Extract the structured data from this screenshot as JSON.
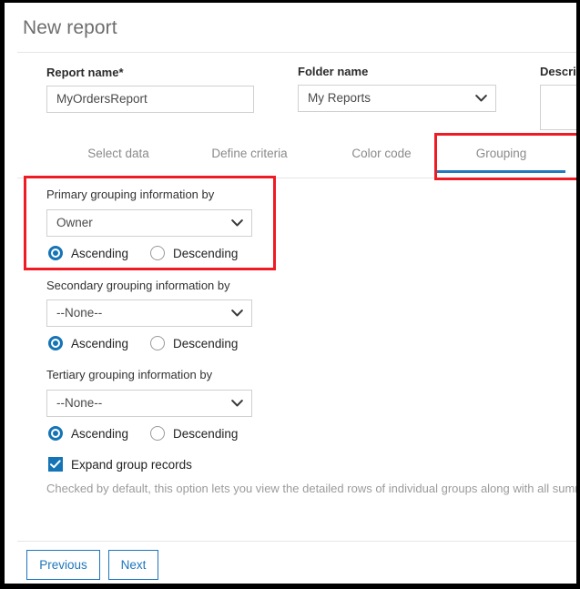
{
  "window": {
    "title": "New report"
  },
  "form": {
    "report_name": {
      "label": "Report name*",
      "value": "MyOrdersReport"
    },
    "folder_name": {
      "label": "Folder name",
      "value": "My Reports"
    },
    "description": {
      "label": "Descri",
      "value": ""
    }
  },
  "tabs": {
    "items": [
      {
        "label": "Select data",
        "active": false
      },
      {
        "label": "Define criteria",
        "active": false
      },
      {
        "label": "Color code",
        "active": false
      },
      {
        "label": "Grouping",
        "active": true
      }
    ],
    "active_underline_color": "#2379bd"
  },
  "grouping": {
    "primary": {
      "label": "Primary grouping information by",
      "value": "Owner",
      "ascending_label": "Ascending",
      "descending_label": "Descending",
      "selected_order": "Ascending"
    },
    "secondary": {
      "label": "Secondary grouping information by",
      "value": "--None--",
      "ascending_label": "Ascending",
      "descending_label": "Descending",
      "selected_order": "Ascending"
    },
    "tertiary": {
      "label": "Tertiary grouping information by",
      "value": "--None--",
      "ascending_label": "Ascending",
      "descending_label": "Descending",
      "selected_order": "Ascending"
    },
    "expand_group_records": {
      "label": "Expand group records",
      "checked": true,
      "help_text": "Checked by default, this option lets you view the detailed rows of individual groups along with all summaries"
    }
  },
  "footer": {
    "previous_label": "Previous",
    "next_label": "Next"
  },
  "annotations": {
    "accent_red": "#ee1b24",
    "accent_blue": "#1574b6"
  }
}
